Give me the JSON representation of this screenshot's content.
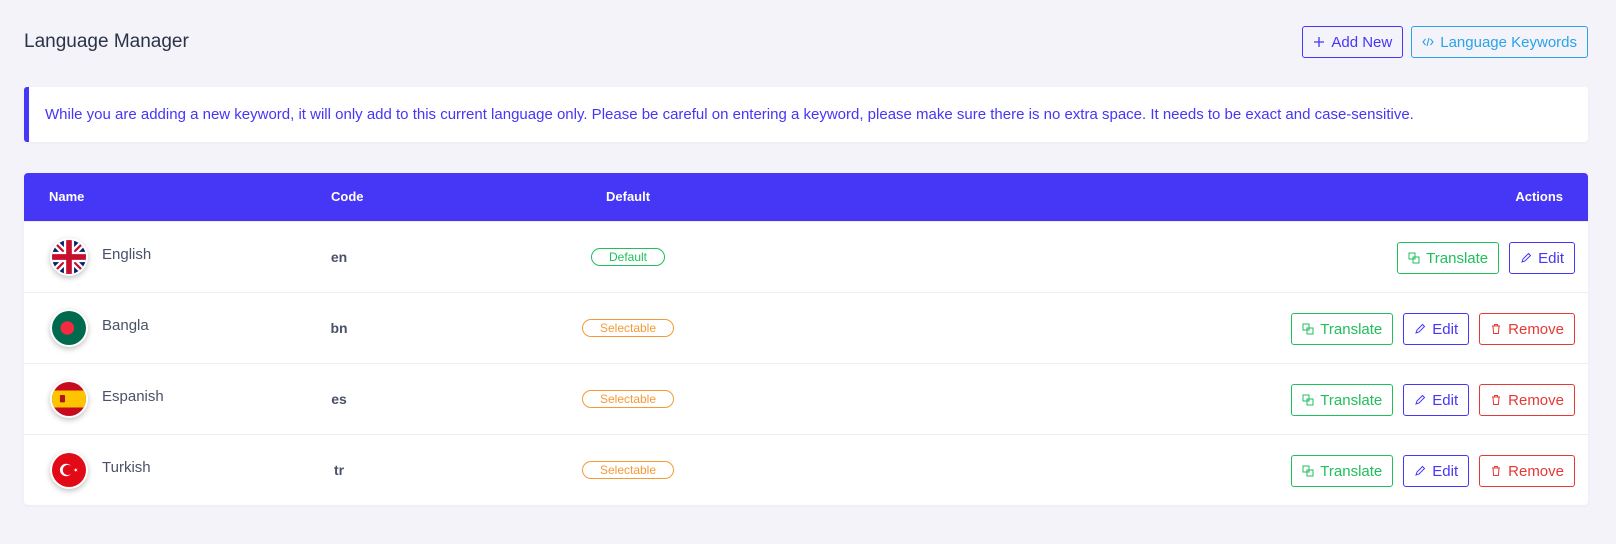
{
  "header": {
    "title": "Language Manager",
    "add_new_label": "Add New",
    "keywords_label": "Language Keywords"
  },
  "alert": {
    "text": "While you are adding a new keyword, it will only add to this current language only. Please be careful on entering a keyword, please make sure there is no extra space. It needs to be exact and case-sensitive."
  },
  "table": {
    "columns": {
      "name": "Name",
      "code": "Code",
      "default": "Default",
      "actions": "Actions"
    },
    "actions": {
      "translate": "Translate",
      "edit": "Edit",
      "remove": "Remove"
    },
    "rows": [
      {
        "name": "English",
        "code": "en",
        "status": "Default",
        "flag": "uk-flag-icon",
        "removable": false
      },
      {
        "name": "Bangla",
        "code": "bn",
        "status": "Selectable",
        "flag": "bangladesh-flag-icon",
        "removable": true
      },
      {
        "name": "Espanish",
        "code": "es",
        "status": "Selectable",
        "flag": "spain-flag-icon",
        "removable": true
      },
      {
        "name": "Turkish",
        "code": "tr",
        "status": "Selectable",
        "flag": "turkey-flag-icon",
        "removable": true
      }
    ]
  },
  "colors": {
    "primary": "#4636f5",
    "info": "#2aa3e8",
    "success": "#1fbf5c",
    "warning": "#f59a36",
    "danger": "#e53935",
    "background": "#f3f3f9"
  }
}
